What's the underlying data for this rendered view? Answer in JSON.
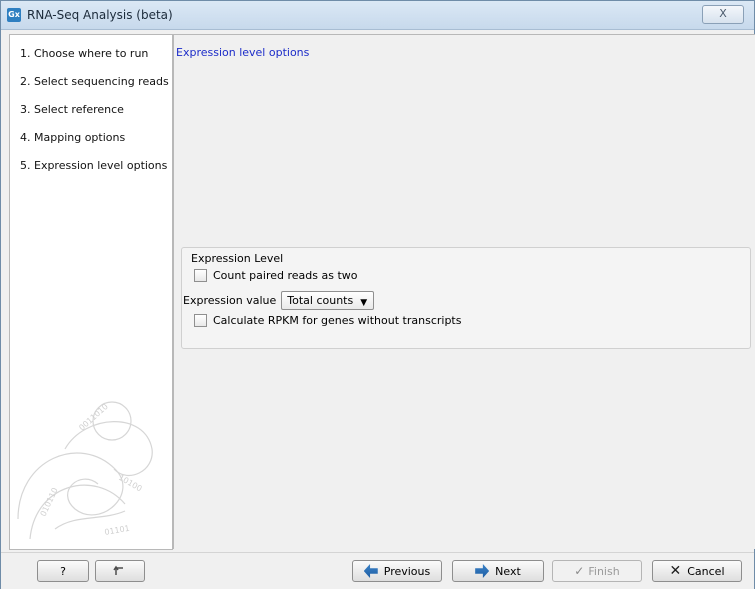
{
  "window": {
    "title": "RNA-Seq Analysis (beta)",
    "app_icon": "Gx",
    "close_label": "X"
  },
  "sidebar": {
    "items": [
      {
        "label": "1.  Choose where to run"
      },
      {
        "label": "2.  Select sequencing reads"
      },
      {
        "label": "3.  Select reference"
      },
      {
        "label": "4.  Mapping options"
      },
      {
        "label": "5.  Expression level options"
      }
    ]
  },
  "main": {
    "section_title": "Expression level options",
    "group": {
      "title": "Expression Level",
      "count_paired_label": "Count paired reads as two",
      "count_paired_checked": false,
      "expression_label": "Expression value",
      "expression_value": "Total counts",
      "rpkm_label": "Calculate RPKM for genes without transcripts",
      "rpkm_checked": false
    }
  },
  "footer": {
    "help_label": "?",
    "reset_icon": "undo-icon",
    "previous_label": "Previous",
    "next_label": "Next",
    "finish_label": "Finish",
    "cancel_label": "Cancel"
  }
}
